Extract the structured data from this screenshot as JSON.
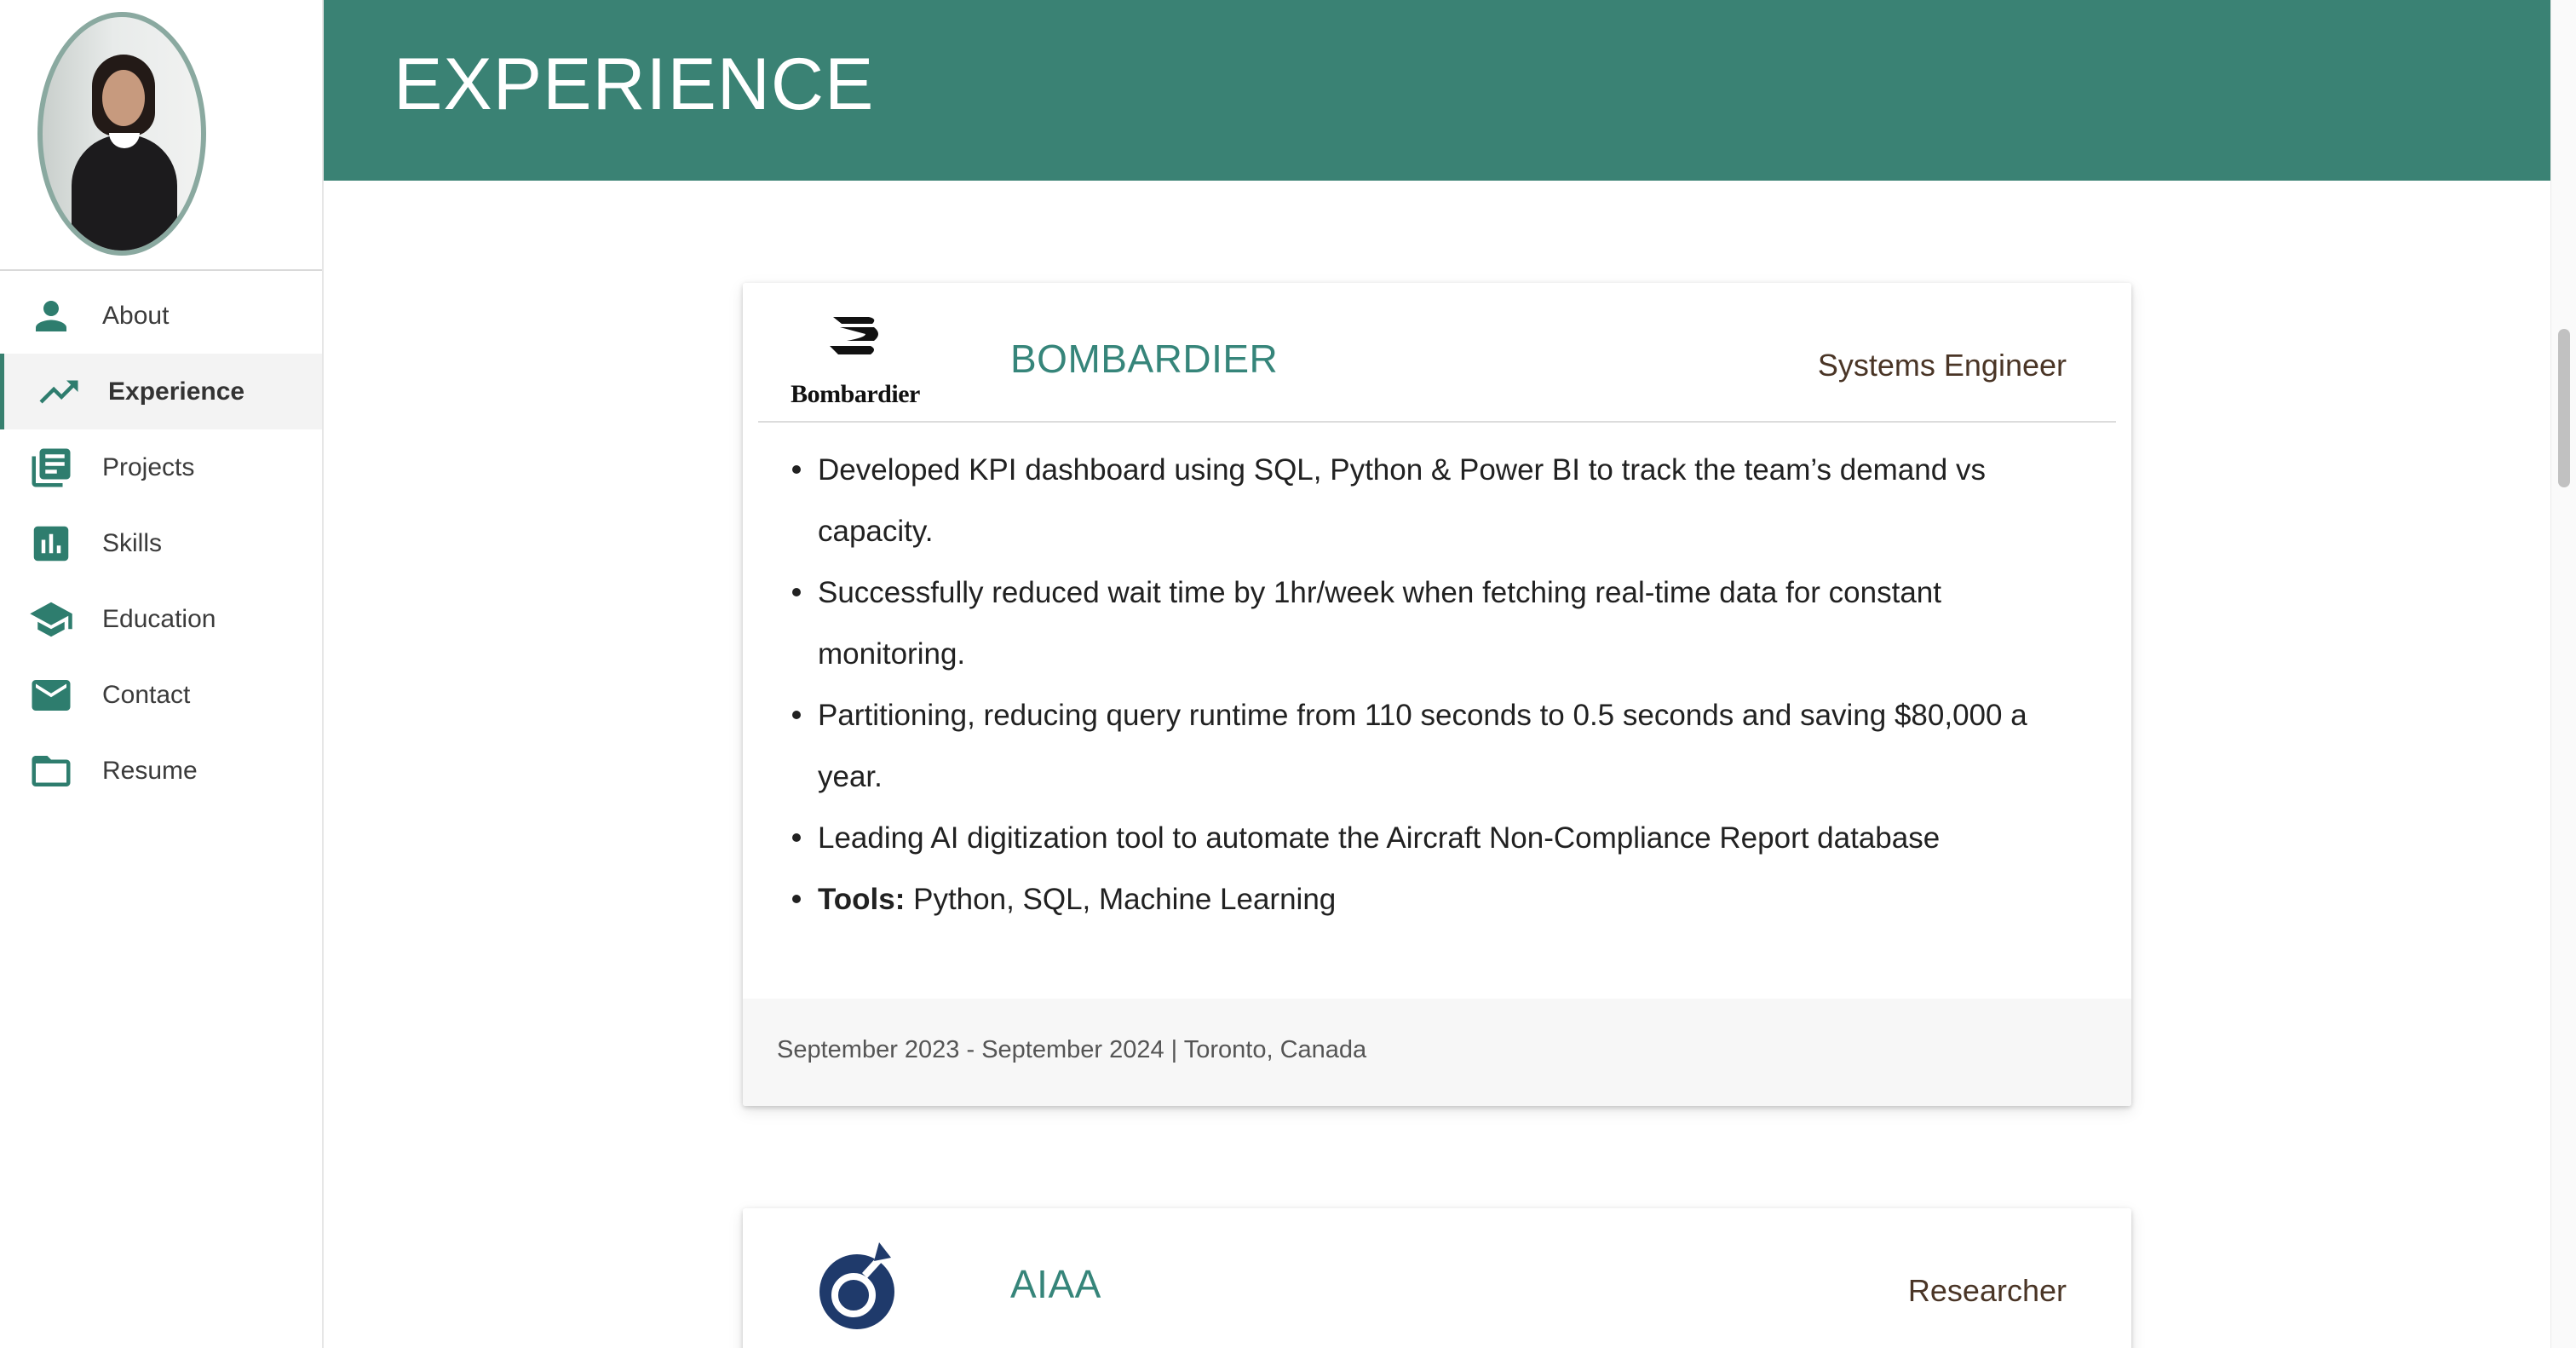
{
  "sidebar": {
    "items": [
      {
        "label": "About",
        "icon": "person-icon"
      },
      {
        "label": "Experience",
        "icon": "trending-up-icon",
        "active": true
      },
      {
        "label": "Projects",
        "icon": "library-books-icon"
      },
      {
        "label": "Skills",
        "icon": "bar-chart-icon"
      },
      {
        "label": "Education",
        "icon": "school-icon"
      },
      {
        "label": "Contact",
        "icon": "mail-icon"
      },
      {
        "label": "Resume",
        "icon": "folder-icon"
      }
    ]
  },
  "header": {
    "title": "EXPERIENCE"
  },
  "colors": {
    "accent": "#3a8274",
    "company_name": "#36857a",
    "job_title": "#4a3526"
  },
  "experiences": [
    {
      "company": "BOMBARDIER",
      "logo_text": "Bombardier",
      "role": "Systems Engineer",
      "bullets": [
        "Developed KPI dashboard using SQL, Python & Power BI to track the team’s demand vs capacity.",
        "Successfully reduced wait time by 1hr/week when fetching real-time data for constant monitoring.",
        "Partitioning, reducing query runtime from 110 seconds to 0.5 seconds and saving $80,000 a year.",
        "Leading AI digitization tool to automate the Aircraft Non-Compliance Report database"
      ],
      "tools_label": "Tools:",
      "tools": " Python, SQL, Machine Learning",
      "footer": "September 2023 - September 2024 | Toronto, Canada"
    },
    {
      "company": "AIAA",
      "role": "Researcher"
    }
  ]
}
